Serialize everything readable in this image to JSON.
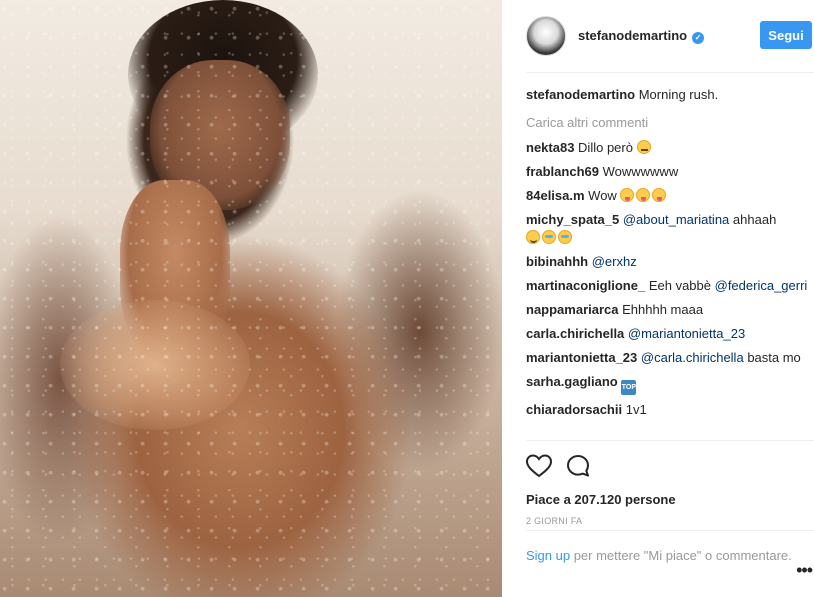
{
  "post": {
    "username": "stefanodemartino",
    "follow_label": "Segui",
    "caption_author": "stefanodemartino",
    "caption_text": "Morning rush.",
    "load_more": "Carica altri commenti"
  },
  "comments": [
    {
      "author": "nekta83",
      "text": "Dillo però",
      "emojis": [
        "worried"
      ]
    },
    {
      "author": "frablanch69",
      "text": "Wowwwwww"
    },
    {
      "author": "84elisa.m",
      "text": "Wow",
      "emojis": [
        "tongue",
        "tongue",
        "tongue"
      ]
    },
    {
      "author": "michy_spata_5",
      "mention": "@about_mariatina",
      "text": "ahhaah",
      "emojis": [
        "smile",
        "tears",
        "tears"
      ]
    },
    {
      "author": "bibinahhh",
      "mention": "@erxhz"
    },
    {
      "author": "martinaconiglione_",
      "text": "Eeh vabbè",
      "mention": "@federica_gerri"
    },
    {
      "author": "nappamariarca",
      "text": "Ehhhhh maaa"
    },
    {
      "author": "carla.chirichella",
      "mention": "@mariantonietta_23"
    },
    {
      "author": "mariantonietta_23",
      "mention": "@carla.chirichella",
      "text": "basta mo"
    },
    {
      "author": "sarha.gagliano",
      "icon": "TOP"
    },
    {
      "author": "chiaradorsachii",
      "text": "1v1"
    }
  ],
  "actions": {
    "likes": "Piace a 207.120 persone",
    "time": "2 GIORNI FA"
  },
  "login": {
    "signup": "Sign up",
    "rest": " per mettere \"Mi piace\" o commentare."
  },
  "more": "•••",
  "colors": {
    "accent": "#3897f0",
    "text": "#262626",
    "muted": "#999999"
  }
}
